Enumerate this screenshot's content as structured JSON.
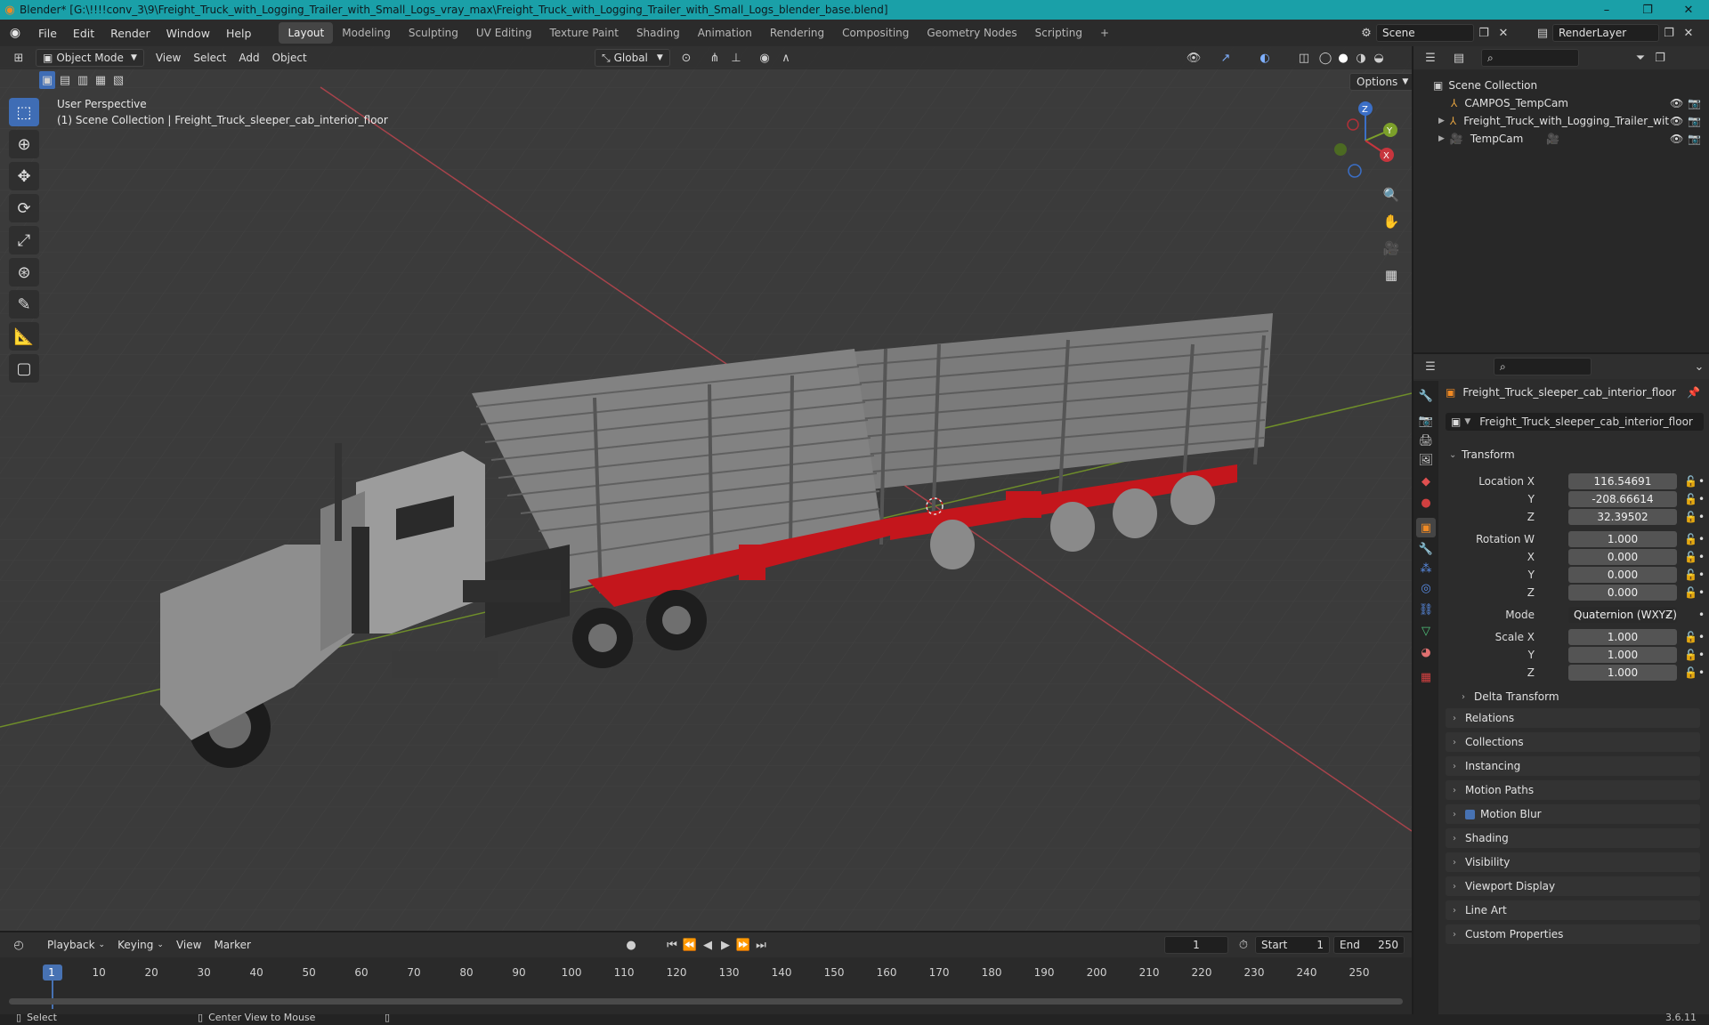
{
  "titlebar": {
    "title": "Blender* [G:\\!!!!conv_3\\9\\Freight_Truck_with_Logging_Trailer_with_Small_Logs_vray_max\\Freight_Truck_with_Logging_Trailer_with_Small_Logs_blender_base.blend]",
    "controls": [
      "–",
      "❐",
      "✕"
    ]
  },
  "menu": {
    "items": [
      "File",
      "Edit",
      "Render",
      "Window",
      "Help"
    ],
    "workspaces": [
      "Layout",
      "Modeling",
      "Sculpting",
      "UV Editing",
      "Texture Paint",
      "Shading",
      "Animation",
      "Rendering",
      "Compositing",
      "Geometry Nodes",
      "Scripting"
    ],
    "active_workspace": "Layout",
    "add_workspace": "+",
    "scene": "Scene",
    "render_layer": "RenderLayer"
  },
  "viewport": {
    "mode": "Object Mode",
    "menus": [
      "View",
      "Select",
      "Add",
      "Object"
    ],
    "orientation": "Global",
    "options": "Options",
    "perspective": "User Perspective",
    "collection_info": "(1) Scene Collection | Freight_Truck_sleeper_cab_interior_floor",
    "gizmo": {
      "x": "X",
      "y": "Y",
      "z": "Z"
    }
  },
  "outliner": {
    "root": "Scene Collection",
    "items": [
      {
        "name": "CAMPOS_TempCam"
      },
      {
        "name": "Freight_Truck_with_Logging_Trailer_wit"
      },
      {
        "name": "TempCam"
      }
    ]
  },
  "properties": {
    "object_name": "Freight_Truck_sleeper_cab_interior_floor",
    "data_name": "Freight_Truck_sleeper_cab_interior_floor",
    "transform_label": "Transform",
    "location": {
      "label": "Location X",
      "x": "116.54691",
      "y": "-208.66614",
      "z": "32.39502"
    },
    "rotation": {
      "label": "Rotation W",
      "w": "1.000",
      "x": "0.000",
      "y": "0.000",
      "z": "0.000"
    },
    "mode_label": "Mode",
    "mode_value": "Quaternion (WXYZ)",
    "scale": {
      "label": "Scale X",
      "x": "1.000",
      "y": "1.000",
      "z": "1.000"
    },
    "axis": {
      "y": "Y",
      "z": "Z",
      "x": "X"
    },
    "delta_transform": "Delta Transform",
    "panels": [
      "Relations",
      "Collections",
      "Instancing",
      "Motion Paths",
      "Motion Blur",
      "Shading",
      "Visibility",
      "Viewport Display",
      "Line Art",
      "Custom Properties"
    ]
  },
  "timeline": {
    "menus": [
      "Playback",
      "Keying",
      "View",
      "Marker"
    ],
    "current_frame": "1",
    "start_label": "Start",
    "start": "1",
    "end_label": "End",
    "end": "250",
    "ticks": [
      "1",
      "10",
      "20",
      "30",
      "40",
      "50",
      "60",
      "70",
      "80",
      "90",
      "100",
      "110",
      "120",
      "130",
      "140",
      "150",
      "160",
      "170",
      "180",
      "190",
      "200",
      "210",
      "220",
      "230",
      "240",
      "250"
    ]
  },
  "status": {
    "left": "Select",
    "middle": "Center View to Mouse",
    "version": "3.6.11"
  },
  "colors": {
    "accent": "#3f6db5",
    "titlebar": "#1aa0a8",
    "trailer_red": "#c4161c",
    "x_axis": "#b3404a",
    "y_axis": "#7a9a2a"
  }
}
